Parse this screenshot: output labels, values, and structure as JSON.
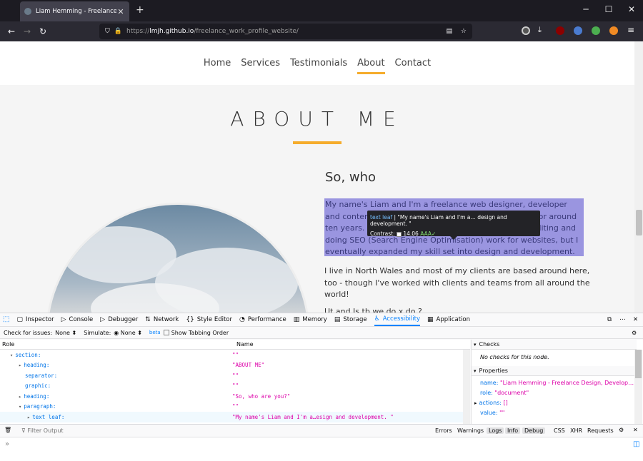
{
  "browser": {
    "tab_title": "Liam Hemming - Freelance Des",
    "new_tab_glyph": "+",
    "url_prefix": "https://",
    "url_domain": "lmjh.github.io",
    "url_path": "/freelance_work_profile_website/"
  },
  "site": {
    "nav": [
      "Home",
      "Services",
      "Testimonials",
      "About",
      "Contact"
    ],
    "active_nav": "About",
    "accent_color": "#f5ac2c",
    "section_title": "ABOUT ME",
    "subheading": "So, who",
    "paragraph1": "My name's Liam and I'm a freelance web designer, developer and content writer. I've been working in this industry for around ten years. I started out on the content side, writing, editing and doing SEO (Search Engine Optimisation) work for websites, but I eventually expanded my skill set into design and development.",
    "paragraph2": "I live in North Wales and most of my clients are based around here, too - though I've worked with clients and teams from all around the world!",
    "paragraph3_partial": "Ut  and  Is  tb  we  do  x  do  ?"
  },
  "tooltip": {
    "role": "text leaf",
    "name": "\"My name's Liam and I'm a… design and development. \"",
    "contrast_label": "Contrast:",
    "contrast_value": "14.06",
    "contrast_rating": "AAA✓"
  },
  "devtools": {
    "tabs": [
      "Inspector",
      "Console",
      "Debugger",
      "Network",
      "Style Editor",
      "Performance",
      "Memory",
      "Storage",
      "Accessibility",
      "Application"
    ],
    "active_tab": "Accessibility",
    "check_label": "Check for issues:",
    "check_value": "None ⬍",
    "simulate_label": "Simulate:",
    "simulate_value": "◉ None ⬍",
    "beta": "beta",
    "tabbing_label": "Show Tabbing Order",
    "col_role": "Role",
    "col_name": "Name",
    "tree": [
      {
        "role": "section:",
        "name": "\"\"",
        "twisty": "▾"
      },
      {
        "role": "heading:",
        "name": "\"ABOUT ME\"",
        "twisty": "▸"
      },
      {
        "role": "separator:",
        "name": "\"\"",
        "twisty": ""
      },
      {
        "role": "graphic:",
        "name": "\"\"",
        "twisty": ""
      },
      {
        "role": "heading:",
        "name": "\"So, who are you?\"",
        "twisty": "▸"
      },
      {
        "role": "paragraph:",
        "name": "\"\"",
        "twisty": "▾"
      },
      {
        "role": "text leaf:",
        "name": "\"My name's Liam and I'm a…esign and development. \"",
        "twisty": "▸"
      }
    ],
    "checks_header": "Checks",
    "checks_text": "No checks for this node.",
    "properties_header": "Properties",
    "props": [
      {
        "k": "name:",
        "v": "\"Liam Hemming - Freelance Design, Develop…"
      },
      {
        "k": "role:",
        "v": "\"document\""
      },
      {
        "k": "actions:",
        "v": "[]"
      },
      {
        "k": "value:",
        "v": "\"\""
      }
    ],
    "console_filter": "Filter Output",
    "console_levels": [
      "Errors",
      "Warnings",
      "Logs",
      "Info",
      "Debug"
    ],
    "console_types": [
      "CSS",
      "XHR",
      "Requests"
    ],
    "prompt": "»"
  }
}
